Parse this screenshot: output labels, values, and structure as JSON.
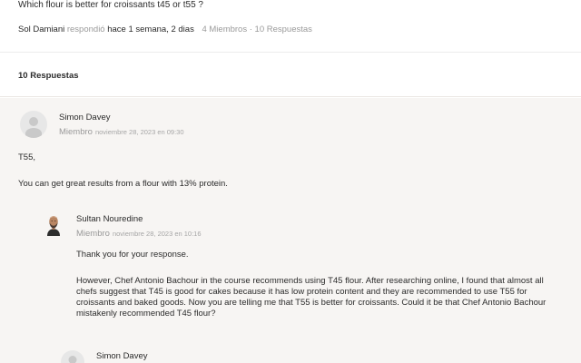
{
  "topic": {
    "title": "Which flour is better for croissants t45 or t55 ?",
    "author": "Sol Damiani",
    "action": "respondió",
    "time": "hace 1 semana, 2 dias",
    "stats": "4 Miembros · 10 Respuestas"
  },
  "replies_heading": "10 Respuestas",
  "replies": [
    {
      "name": "Simon Davey",
      "role": "Miembro",
      "date": "noviembre 28, 2023 en 09:30",
      "paragraphs": [
        "T55,",
        "You can get great results from a flour with 13% protein."
      ]
    },
    {
      "name": "Sultan Nouredine",
      "role": "Miembro",
      "date": "noviembre 28, 2023 en 10:16",
      "paragraphs": [
        "Thank you for your response.",
        "However, Chef Antonio Bachour in the course recommends using T45 flour. After researching online, I found that almost all chefs suggest that T45 is good for cakes because it has low protein content and they are recommended to use T55 for croissants and baked goods. Now you are telling me that T55 is better for croissants. Could it be that Chef Antonio Bachour mistakenly recommended T45 flour?"
      ]
    },
    {
      "name": "Simon Davey"
    }
  ]
}
